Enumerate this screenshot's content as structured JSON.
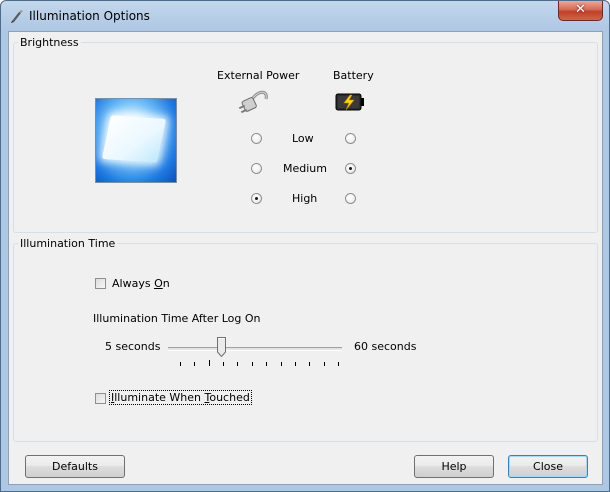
{
  "window": {
    "title": "Illumination Options",
    "icons": {
      "app": "pen-lamp-icon",
      "close": "close-x-icon"
    },
    "accent_color": "#aec7e3"
  },
  "brightness": {
    "group_label": "Brightness",
    "preview_icon": "illuminated-keyboard-preview-icon",
    "columns": {
      "external_power": {
        "label": "External Power",
        "icon": "power-plug-icon"
      },
      "battery": {
        "label": "Battery",
        "icon": "battery-charging-icon"
      }
    },
    "levels": [
      {
        "label": "Low",
        "external_selected": false,
        "battery_selected": false
      },
      {
        "label": "Medium",
        "external_selected": false,
        "battery_selected": true
      },
      {
        "label": "High",
        "external_selected": true,
        "battery_selected": false
      }
    ]
  },
  "illumination_time": {
    "group_label": "Illumination Time",
    "always_on": {
      "label_prefix": "Always ",
      "label_access_key": "O",
      "label_suffix": "n",
      "checked": false
    },
    "slider_label": "Illumination Time After Log On",
    "slider": {
      "min_label": "5 seconds",
      "max_label": "60 seconds",
      "tick_count": 12,
      "selected_index": 2
    },
    "illuminate_when_touched": {
      "label_access_key": "I",
      "label_middle": "lluminate When ",
      "label_access_key2": "T",
      "label_suffix": "ouched",
      "checked": false
    }
  },
  "buttons": {
    "defaults": "Defaults",
    "help": "Help",
    "close": "Close"
  }
}
